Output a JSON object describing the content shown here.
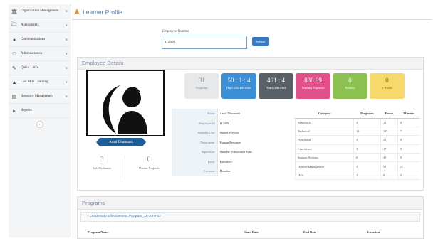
{
  "sidebar": {
    "items": [
      {
        "label": "Organization Management",
        "icon": "bank-icon"
      },
      {
        "label": "Assessments",
        "icon": "folder-icon"
      },
      {
        "label": "Communications",
        "icon": "chat-icon"
      },
      {
        "label": "Administration",
        "icon": "monitor-icon"
      },
      {
        "label": "Quick Links",
        "icon": "link-icon"
      },
      {
        "label": "Last Mile Learning",
        "icon": "road-icon"
      },
      {
        "label": "Resource Management",
        "icon": "database-icon"
      },
      {
        "label": "Reports",
        "icon": "caret-right-icon"
      }
    ]
  },
  "header": {
    "title": "Learner Profile"
  },
  "search": {
    "label": "Employee Number",
    "value": "112409",
    "submit_label": "Submit"
  },
  "details": {
    "title": "Employee Details",
    "employee_name": "Amol Dharmank",
    "counts": [
      {
        "value": "3",
        "label": "Sub-Ordinates"
      },
      {
        "value": "0",
        "label": "Mentor Projects"
      }
    ],
    "stats": [
      {
        "value": "31",
        "label": "Programs",
        "bg": "#e6e8ea",
        "fg": "#7a8aa0"
      },
      {
        "value": "50 : 1 : 4",
        "label": "Days (DD:HH:MM)",
        "bg": "#3a8fd6",
        "fg": "#ffffff"
      },
      {
        "value": "401 : 4",
        "label": "Hours (HH:MM)",
        "bg": "#5a6068",
        "fg": "#ffffff"
      },
      {
        "value": "888.89",
        "label": "Training Expenses",
        "bg": "#e34f88",
        "fg": "#ffffff"
      },
      {
        "value": "0",
        "label": "Projects",
        "bg": "#8cc152",
        "fg": "#ffffff"
      },
      {
        "value": "0",
        "label": "e-Books",
        "bg": "#f6d96a",
        "fg": "#7a6a2a"
      }
    ],
    "info": [
      {
        "key": "Name",
        "value": "Amol Dharmank"
      },
      {
        "key": "Employee Id",
        "value": "112409"
      },
      {
        "key": "Business Unit",
        "value": "Shared Services"
      },
      {
        "key": "Department",
        "value": "Human Resource"
      },
      {
        "key": "Supervisor",
        "value": "Shradha Vishwanath Rane"
      },
      {
        "key": "Level",
        "value": "Executive"
      },
      {
        "key": "Location",
        "value": "Mumbai"
      }
    ],
    "categories": {
      "headers": [
        "Category",
        "Programs",
        "Hours",
        "Minutes"
      ],
      "rows": [
        [
          "Behavioral",
          "3",
          "12",
          "0"
        ],
        [
          "Technical",
          "14",
          "235",
          "7"
        ],
        [
          "Functional",
          "3",
          "21",
          "0"
        ],
        [
          "Conference",
          "3",
          "17",
          "0"
        ],
        [
          "Support Systems",
          "6",
          "49",
          "0"
        ],
        [
          "General Management",
          "3",
          "51",
          "57"
        ],
        [
          "IMS",
          "2",
          "8",
          "0"
        ]
      ]
    }
  },
  "programs": {
    "title": "Programs",
    "group": "Leadership Effectiveness Program_16-June-17",
    "columns": [
      "Program Name",
      "Start Date",
      "End Date",
      "Location"
    ]
  }
}
